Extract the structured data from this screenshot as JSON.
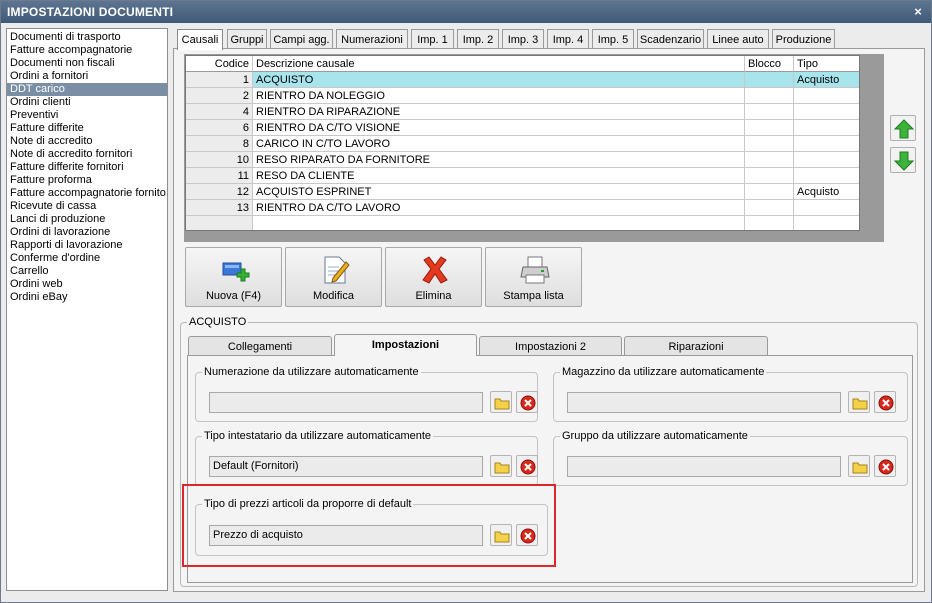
{
  "window": {
    "title": "IMPOSTAZIONI DOCUMENTI",
    "close": "×"
  },
  "documents": [
    "Documenti di trasporto",
    "Fatture accompagnatorie",
    "Documenti non fiscali",
    "Ordini a fornitori",
    "DDT carico",
    "Ordini clienti",
    "Preventivi",
    "Fatture differite",
    "Note di accredito",
    "Note di accredito fornitori",
    "Fatture differite fornitori",
    "Fatture proforma",
    "Fatture accompagnatorie fornito",
    "Ricevute di cassa",
    "Lanci di produzione",
    "Ordini di lavorazione",
    "Rapporti di lavorazione",
    "Conferme d'ordine",
    "Carrello",
    "Ordini web",
    "Ordini eBay"
  ],
  "selected_document": "DDT carico",
  "tabs": [
    "Causali",
    "Gruppi",
    "Campi agg.",
    "Numerazioni",
    "Imp. 1",
    "Imp. 2",
    "Imp. 3",
    "Imp. 4",
    "Imp. 5",
    "Scadenzario",
    "Linee auto",
    "Produzione"
  ],
  "active_tab": "Causali",
  "grid": {
    "headers": {
      "code": "Codice",
      "desc": "Descrizione causale",
      "block": "Blocco",
      "type": "Tipo"
    },
    "rows": [
      {
        "code": "1",
        "desc": "ACQUISTO",
        "block": "",
        "type": "Acquisto"
      },
      {
        "code": "2",
        "desc": "RIENTRO DA NOLEGGIO",
        "block": "",
        "type": ""
      },
      {
        "code": "4",
        "desc": "RIENTRO DA RIPARAZIONE",
        "block": "",
        "type": ""
      },
      {
        "code": "6",
        "desc": "RIENTRO DA C/TO VISIONE",
        "block": "",
        "type": ""
      },
      {
        "code": "8",
        "desc": "CARICO IN C/TO LAVORO",
        "block": "",
        "type": ""
      },
      {
        "code": "10",
        "desc": "RESO RIPARATO DA FORNITORE",
        "block": "",
        "type": ""
      },
      {
        "code": "11",
        "desc": "RESO DA CLIENTE",
        "block": "",
        "type": ""
      },
      {
        "code": "12",
        "desc": "ACQUISTO ESPRINET",
        "block": "",
        "type": "Acquisto"
      },
      {
        "code": "13",
        "desc": "RIENTRO DA C/TO LAVORO",
        "block": "",
        "type": ""
      }
    ]
  },
  "actions": {
    "new": "Nuova (F4)",
    "edit": "Modifica",
    "delete": "Elimina",
    "print": "Stampa lista"
  },
  "section": {
    "title": "ACQUISTO",
    "tabs": [
      "Collegamenti",
      "Impostazioni",
      "Impostazioni 2",
      "Riparazioni"
    ],
    "active_tab": "Impostazioni",
    "fields": {
      "numerazione": {
        "label": "Numerazione da utilizzare automaticamente",
        "value": ""
      },
      "magazzino": {
        "label": "Magazzino da utilizzare automaticamente",
        "value": ""
      },
      "intestatario": {
        "label": "Tipo intestatario da utilizzare automaticamente",
        "value": "Default (Fornitori)"
      },
      "gruppo": {
        "label": "Gruppo da utilizzare automaticamente",
        "value": ""
      },
      "prezzi": {
        "label": "Tipo di prezzi articoli da proporre di default",
        "value": "Prezzo di acquisto"
      }
    }
  },
  "colors": {
    "titlebar": "#4b6584",
    "selection": "#a8e4ec",
    "list_selection": "#7a8ea6",
    "highlight": "#e0262c"
  }
}
